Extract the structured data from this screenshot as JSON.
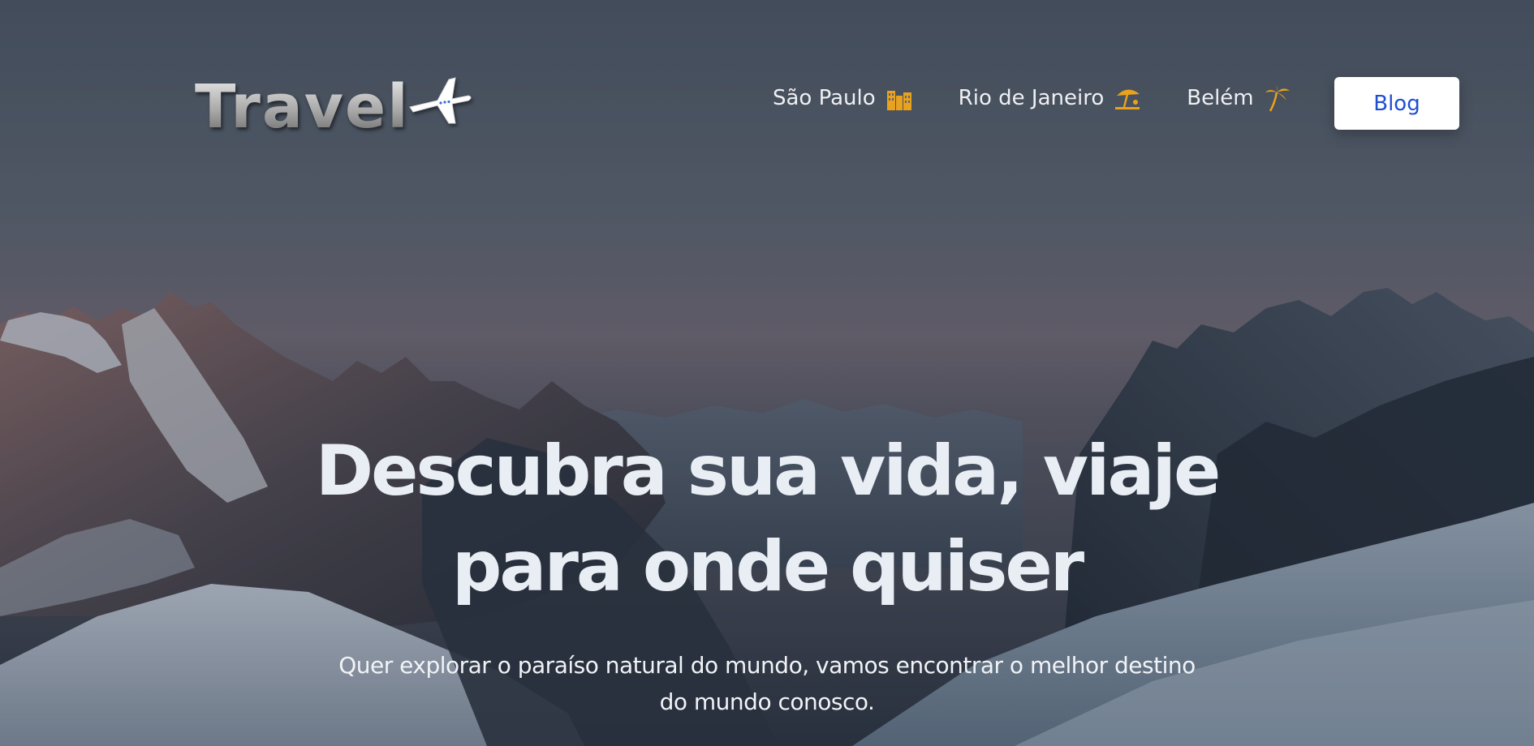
{
  "header": {
    "logo_text": "Travel",
    "nav": [
      {
        "label": "São Paulo",
        "icon": "city-buildings-icon"
      },
      {
        "label": "Rio de Janeiro",
        "icon": "beach-umbrella-icon"
      },
      {
        "label": "Belém",
        "icon": "palm-tree-icon"
      }
    ],
    "blog_label": "Blog"
  },
  "hero": {
    "title": "Descubra sua vida, viaje para onde quiser",
    "subtitle": "Quer explorar o paraíso natural do mundo, vamos encontrar o melhor destino do mundo conosco."
  },
  "colors": {
    "accent_icon": "#e9a21c",
    "blog_text": "#1f4fd1",
    "sky_top": "#4a5564",
    "sky_mid": "#6a6770"
  }
}
